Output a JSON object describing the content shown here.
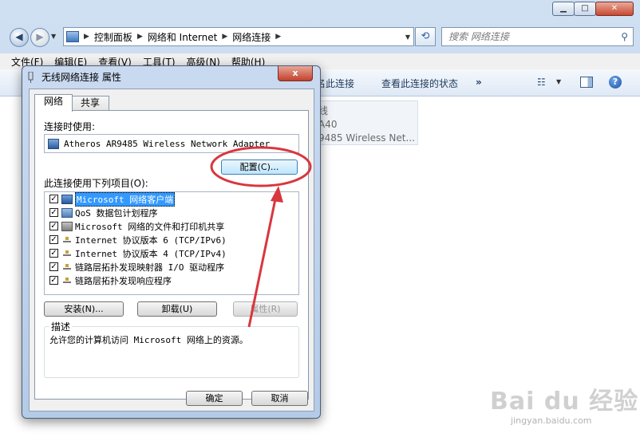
{
  "explorer": {
    "breadcrumbs": [
      "控制面板",
      "网络和 Internet",
      "网络连接"
    ],
    "search_placeholder": "搜索 网络连接",
    "menu": [
      "文件(F)",
      "编辑(E)",
      "查看(V)",
      "工具(T)",
      "高级(N)",
      "帮助(H)"
    ],
    "commands": [
      "名此连接",
      "查看此连接的状态",
      "»"
    ],
    "adapter_tile": {
      "line1": "线",
      "line2": "A40",
      "line3": "9485 Wireless Net..."
    },
    "watermark": "Bai du 经验",
    "watermark_url": "jingyan.baidu.com"
  },
  "dialog": {
    "title": "无线网络连接 属性",
    "close_label": "x",
    "tabs": [
      "网络",
      "共享"
    ],
    "connect_using_label": "连接时使用:",
    "adapter_name": "Atheros AR9485 Wireless Network Adapter",
    "configure_label": "配置(C)...",
    "items_label": "此连接使用下列项目(O):",
    "items": [
      {
        "label": "Microsoft 网络客户端",
        "checked": true,
        "icon": "network-client-icon",
        "selected": true
      },
      {
        "label": "QoS 数据包计划程序",
        "checked": true,
        "icon": "qos-scheduler-icon",
        "selected": false
      },
      {
        "label": "Microsoft 网络的文件和打印机共享",
        "checked": true,
        "icon": "file-printer-sharing-icon",
        "selected": false
      },
      {
        "label": "Internet 协议版本 6 (TCP/IPv6)",
        "checked": true,
        "icon": "protocol-icon",
        "selected": false
      },
      {
        "label": "Internet 协议版本 4 (TCP/IPv4)",
        "checked": true,
        "icon": "protocol-icon",
        "selected": false
      },
      {
        "label": "链路层拓扑发现映射器 I/O 驱动程序",
        "checked": true,
        "icon": "protocol-icon",
        "selected": false
      },
      {
        "label": "链路层拓扑发现响应程序",
        "checked": true,
        "icon": "protocol-icon",
        "selected": false
      }
    ],
    "install_label": "安装(N)...",
    "uninstall_label": "卸载(U)",
    "properties_label": "属性(R)",
    "description_title": "描述",
    "description_text": "允许您的计算机访问 Microsoft 网络上的资源。",
    "ok_label": "确定",
    "cancel_label": "取消"
  },
  "annotation_color": "#d9363e"
}
